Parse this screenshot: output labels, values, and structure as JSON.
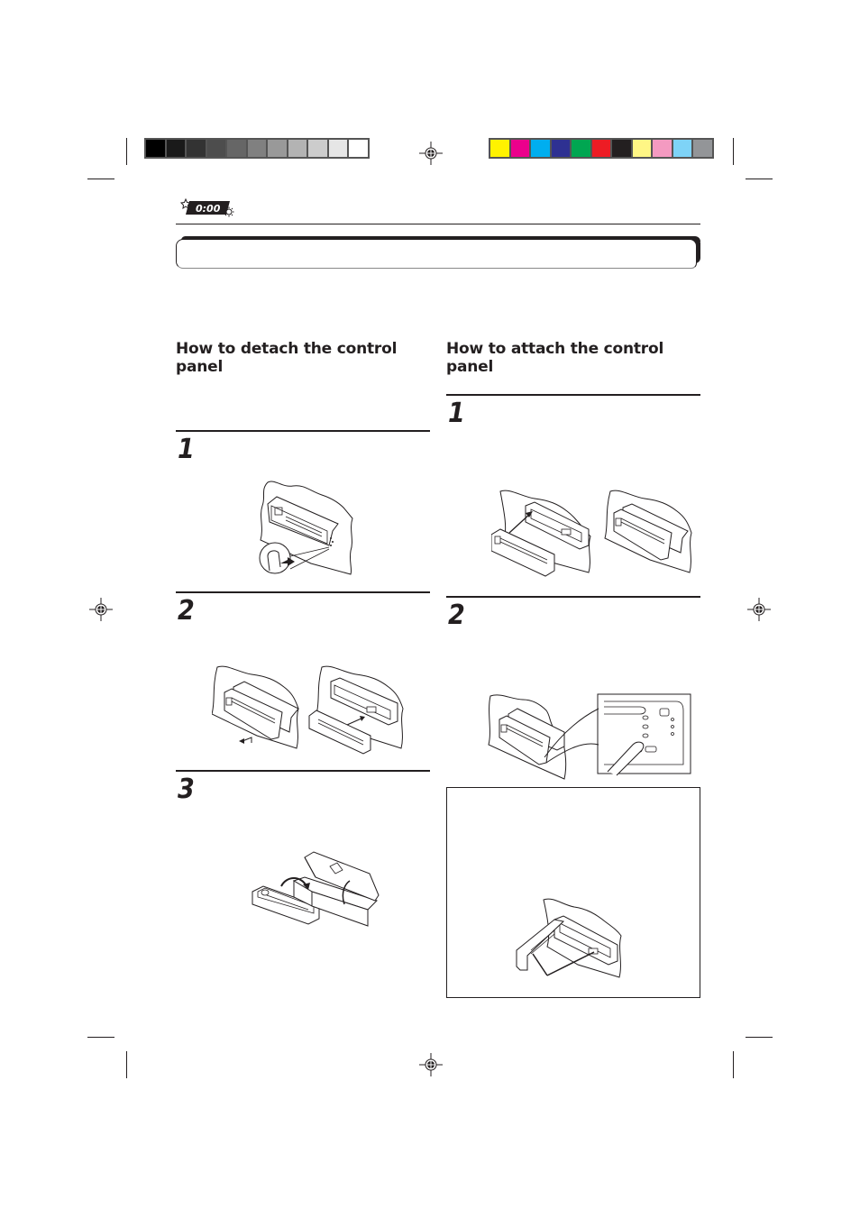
{
  "page": {
    "header_icon": {
      "name": "clock-display-icon",
      "clock_text": "0:00"
    },
    "title_banner": {
      "text": ""
    },
    "color_bars": {
      "grayscale": [
        "#000000",
        "#1a1a1a",
        "#333333",
        "#4d4d4d",
        "#666666",
        "#808080",
        "#999999",
        "#b3b3b3",
        "#cccccc",
        "#e6e6e6",
        "#ffffff"
      ],
      "process": [
        "#fff200",
        "#ec008c",
        "#00aeef",
        "#2e3192",
        "#00a651",
        "#ed1c24",
        "#231f20",
        "#fff685",
        "#f49ac1",
        "#7ed3f7",
        "#939598"
      ]
    }
  },
  "detach": {
    "heading": "How to detach the control panel",
    "steps": [
      {
        "number": "1",
        "illustration": "press-release-button-illustration"
      },
      {
        "number": "2",
        "illustration": "pull-out-panel-illustration"
      },
      {
        "number": "3",
        "illustration": "panel-in-case-illustration"
      }
    ]
  },
  "attach": {
    "heading": "How to attach the control panel",
    "steps": [
      {
        "number": "1",
        "illustration": "insert-panel-illustration"
      },
      {
        "number": "2",
        "illustration": "press-panel-illustration"
      }
    ],
    "note": {
      "illustration": "connector-caution-illustration"
    }
  }
}
